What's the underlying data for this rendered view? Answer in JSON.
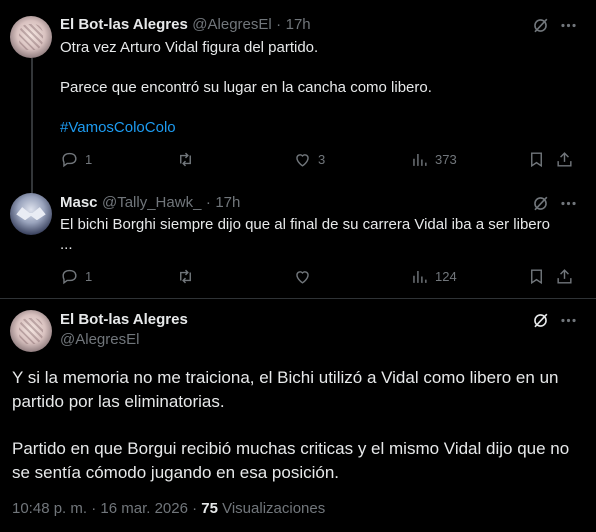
{
  "tweet1": {
    "name": "El Bot-las Alegres",
    "handle": "@AlegresEl",
    "dot": "·",
    "time": "17h",
    "line1": "Otra vez Arturo Vidal figura del partido.",
    "line2": "Parece que encontró su lugar en la cancha como libero.",
    "hashtag": "#VamosColoColo",
    "replies": "1",
    "retweets": "",
    "likes": "3",
    "views": "373"
  },
  "tweet2": {
    "name": "Masc",
    "handle": "@Tally_Hawk_",
    "dot": "·",
    "time": "17h",
    "line1": "El bichi Borghi  siempre dijo que al final de su carrera Vidal  iba a ser libero",
    "line2": "...",
    "replies": "1",
    "retweets": "",
    "likes": "",
    "views": "124"
  },
  "main": {
    "name": "El Bot-las Alegres",
    "handle": "@AlegresEl",
    "para1": "Y si la memoria no me traiciona, el Bichi utilizó a Vidal como libero en un partido por las eliminatorias.",
    "para2": "Partido en que Borgui recibió muchas criticas y el mismo Vidal dijo que no se sentía cómodo jugando en esa posición.",
    "timestamp": "10:48 p. m. · 16 mar. 2026 · ",
    "views_count": "75",
    "views_label": " Visualizaciones"
  },
  "icons": [
    "grok-icon",
    "more-icon",
    "reply-icon",
    "retweet-icon",
    "like-icon",
    "views-icon",
    "bookmark-icon",
    "share-icon"
  ]
}
